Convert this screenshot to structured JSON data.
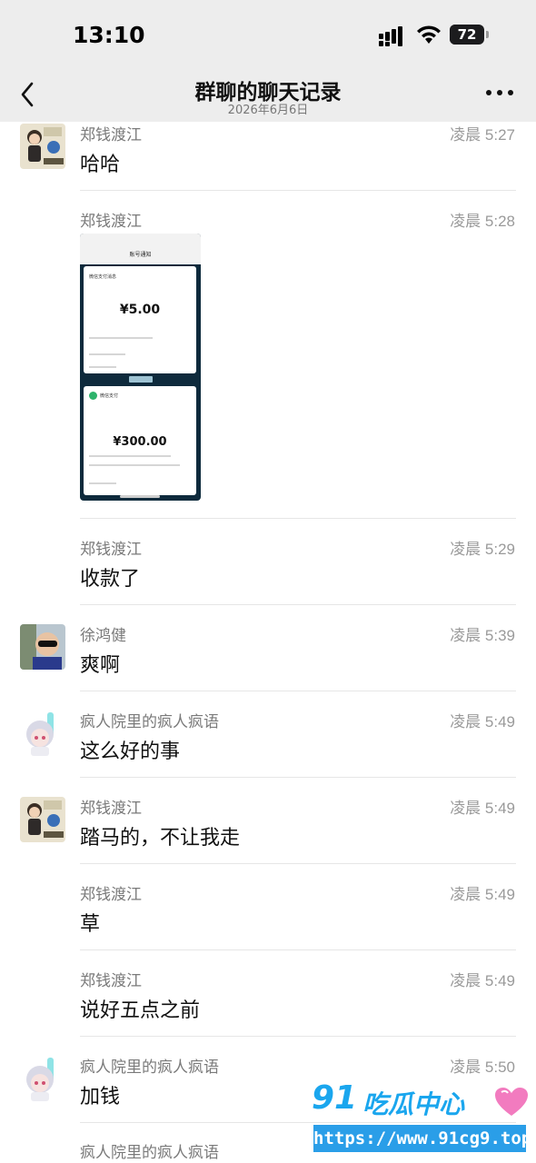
{
  "status_bar": {
    "time": "13:10",
    "battery_percent": 72,
    "battery_label": "72",
    "icons": [
      "cellular-signal-icon",
      "wifi-icon",
      "battery-icon"
    ]
  },
  "nav": {
    "back_icon": "chevron-left-icon",
    "title": "群聊的聊天记录",
    "date": "2026年6月6日",
    "more_icon": "more-dots-icon"
  },
  "messages": [
    {
      "sender": "郑钱渡江",
      "time": "凌晨 5:27",
      "text": "哈哈",
      "avatar": true,
      "avatar_kind": "boy"
    },
    {
      "sender": "郑钱渡江",
      "time": "凌晨 5:28",
      "image": true
    },
    {
      "sender": "郑钱渡江",
      "time": "凌晨 5:29",
      "text": "收款了"
    },
    {
      "sender": "徐鸿健",
      "time": "凌晨 5:39",
      "text": "爽啊",
      "avatar": true,
      "avatar_kind": "kid-sunglasses"
    },
    {
      "sender": "疯人院里的疯人疯语",
      "time": "凌晨 5:49",
      "text": "这么好的事",
      "avatar": true,
      "avatar_kind": "chibi"
    },
    {
      "sender": "郑钱渡江",
      "time": "凌晨 5:49",
      "text": "踏马的，不让我走",
      "avatar": true,
      "avatar_kind": "boy"
    },
    {
      "sender": "郑钱渡江",
      "time": "凌晨 5:49",
      "text": "草"
    },
    {
      "sender": "郑钱渡江",
      "time": "凌晨 5:49",
      "text": "说好五点之前"
    },
    {
      "sender": "疯人院里的疯人疯语",
      "time": "凌晨 5:50",
      "text": "加钱",
      "avatar": true,
      "avatar_kind": "chibi"
    },
    {
      "sender": "疯人院里的疯人疯语",
      "time": "",
      "text": ""
    }
  ],
  "screenshot_image": {
    "nav_title": "账号通知",
    "card1_title": "微信支付消息",
    "card1_amount": "¥5.00",
    "card2_title": "微信支付",
    "card2_amount": "¥300.00"
  },
  "watermark": {
    "brand_number": "91",
    "brand_text": "吃瓜中心",
    "url": "https://www.91cg9.top"
  },
  "colors": {
    "header_bg": "#ededed",
    "watermark_blue": "#1aa6ee",
    "watermark_url_bg": "#2a9ee8"
  }
}
